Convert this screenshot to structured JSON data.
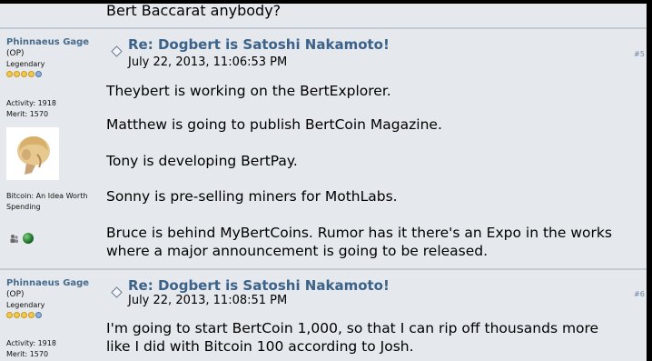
{
  "previous_post_tail": "Bert Baccarat anybody?",
  "posts": [
    {
      "poster": {
        "name": "Phinnaeus Gage",
        "op_label": "(OP)",
        "rank": "Legendary",
        "activity": "Activity: 1918",
        "merit": "Merit: 1570",
        "personal_text": "Bitcoin: An Idea Worth Spending"
      },
      "subject": "Re: Dogbert is Satoshi Nakamoto!",
      "date": "July 22, 2013, 11:06:53 PM",
      "post_number": "#5",
      "paragraphs": [
        "Theybert is working on the BertExplorer.",
        "Matthew is going to publish BertCoin Magazine.",
        "Tony is developing BertPay.",
        "Sonny is pre-selling miners for MothLabs.",
        "Bruce is behind MyBertCoins. Rumor has it there's an Expo in the works",
        "where a major announcement is going to be released."
      ]
    },
    {
      "poster": {
        "name": "Phinnaeus Gage",
        "op_label": "(OP)",
        "rank": "Legendary",
        "activity": "Activity: 1918",
        "merit": "Merit: 1570"
      },
      "subject": "Re: Dogbert is Satoshi Nakamoto!",
      "date": "July 22, 2013, 11:08:51 PM",
      "post_number": "#6",
      "paragraphs": [
        "I'm going to start BertCoin 1,000, so that I can rip off thousands more",
        "like I did with Bitcoin 100 according to Josh."
      ]
    }
  ],
  "colors": {
    "background": "#e5e8ec",
    "poster_name": "#476c8e",
    "subject": "#3b6289"
  },
  "icons": [
    "message-icon",
    "person-icon",
    "globe-icon",
    "avatar-image"
  ]
}
